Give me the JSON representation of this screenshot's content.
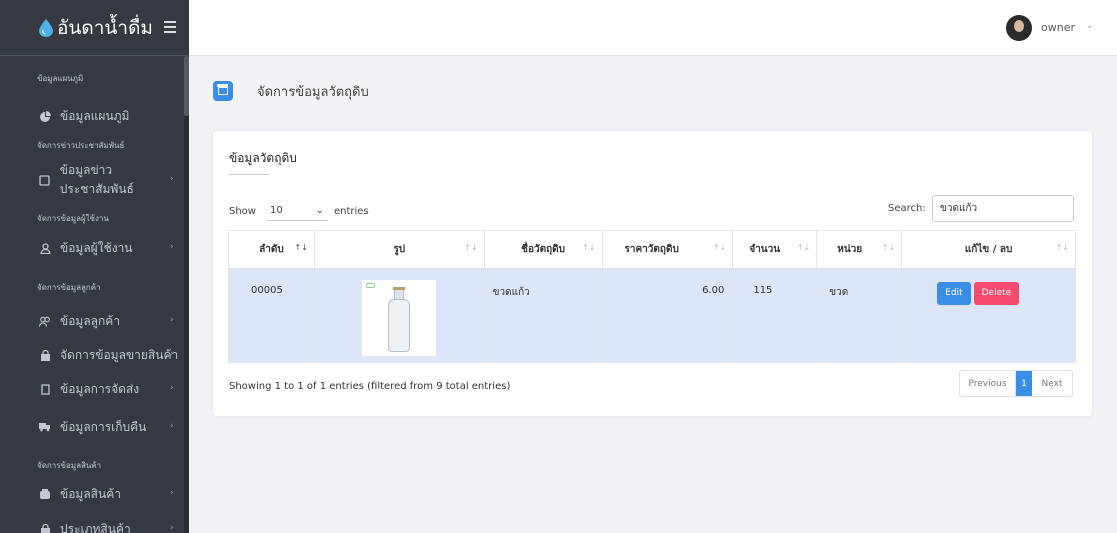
{
  "brand": {
    "title": "อันดาน้ำดื่ม"
  },
  "user": {
    "name": "owner"
  },
  "sidebar": {
    "headers": [
      "ข้อมูลแผนภูมิ",
      "จัดการข่าวประชาสัมพันธ์",
      "จัดการข้อมูลผู้ใช้งาน",
      "จัดการข้อมูลลูกค้า",
      "จัดการข้อมูลสินค้า"
    ],
    "items": [
      {
        "label": "ข้อมูลแผนภูมิ",
        "icon": "pie-chart-icon"
      },
      {
        "label": "ข้อมูลข่าวประชาสัมพันธ์",
        "icon": "newspaper-icon"
      },
      {
        "label": "ข้อมูลผู้ใช้งาน",
        "icon": "user-icon"
      },
      {
        "label": "ข้อมูลลูกค้า",
        "icon": "users-icon"
      },
      {
        "label": "จัดการข้อมูลขายสินค้า",
        "icon": "shopping-bag-icon"
      },
      {
        "label": "ข้อมูลการจัดส่ง",
        "icon": "box-icon"
      },
      {
        "label": "ข้อมูลการเก็บคืน",
        "icon": "truck-icon"
      },
      {
        "label": "ข้อมูลสินค้า",
        "icon": "bottle-icon"
      },
      {
        "label": "ประเภทสินค้า",
        "icon": "tag-icon"
      }
    ]
  },
  "page": {
    "title": "จัดการข้อมูลวัตถุดิบ"
  },
  "card": {
    "title": "ข้อมูลวัตถุดิบ"
  },
  "table_controls": {
    "show": "Show",
    "entries_value": "10",
    "entries": "entries",
    "search_label": "Search:",
    "search_value": "ขวดแก้ว"
  },
  "table": {
    "columns": [
      "ลำดับ",
      "รูป",
      "ชื่อวัตถุดิบ",
      "ราคาวัตถุดิบ",
      "จำนวน",
      "หน่วย",
      "แก้ไข / ลบ"
    ],
    "rows": [
      {
        "id": "00005",
        "name": "ขวดแก้ว",
        "price": "6.00",
        "qty": "115",
        "unit": "ขวด",
        "edit": "Edit",
        "delete": "Delete"
      }
    ]
  },
  "footer": {
    "info": "Showing 1 to 1 of 1 entries (filtered from 9 total entries)",
    "previous": "Previous",
    "current_page": "1",
    "next": "Next"
  },
  "colors": {
    "sidebar": "#343a40",
    "accent": "#3a8ee6",
    "danger": "#f44b6e",
    "row_highlight": "#dde6f8"
  }
}
